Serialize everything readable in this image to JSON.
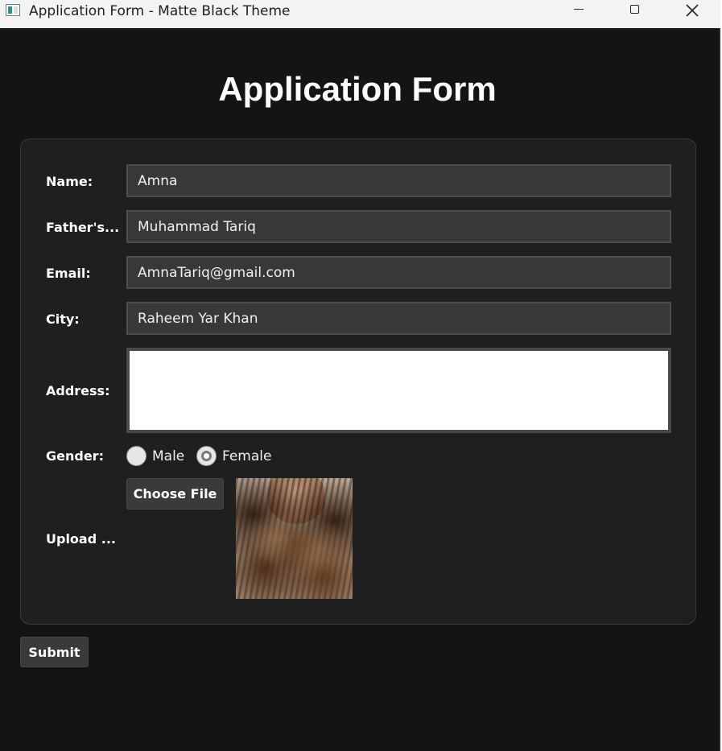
{
  "window": {
    "title": "Application Form - Matte Black Theme"
  },
  "page": {
    "heading": "Application Form"
  },
  "form": {
    "name": {
      "label": "Name:",
      "value": "Amna"
    },
    "father": {
      "label": "Father's...",
      "value": "Muhammad Tariq"
    },
    "email": {
      "label": "Email:",
      "value": "AmnaTariq@gmail.com"
    },
    "city": {
      "label": "City:",
      "value": "Raheem Yar Khan"
    },
    "address": {
      "label": "Address:",
      "value": ""
    },
    "gender": {
      "label": "Gender:",
      "options": [
        {
          "label": "Male",
          "selected": false
        },
        {
          "label": "Female",
          "selected": true
        }
      ]
    },
    "upload": {
      "label": "Upload ...",
      "button_label": "Choose File",
      "preview": "uploaded-photo"
    }
  },
  "actions": {
    "submit_label": "Submit"
  },
  "colors": {
    "background": "#141414",
    "panel": "#1f1f1f",
    "field": "#383838",
    "button": "#3a3a3a",
    "text": "#ffffff"
  },
  "icons": {
    "app": "app-icon",
    "minimize": "minimize-icon",
    "maximize": "maximize-icon",
    "close": "close-icon"
  }
}
